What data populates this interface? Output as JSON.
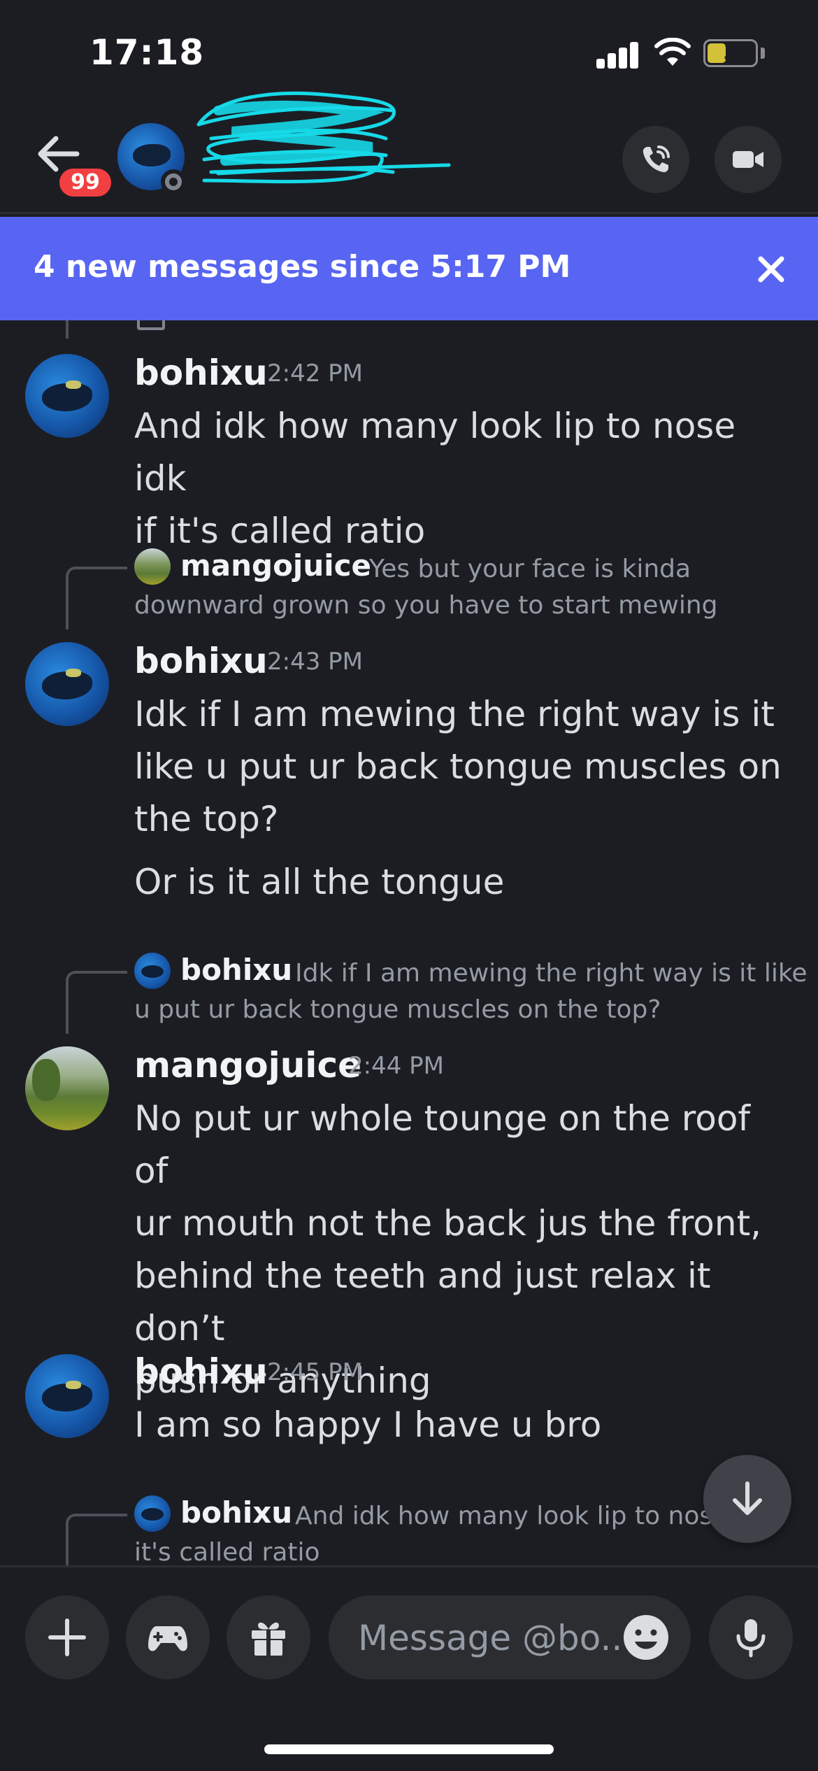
{
  "status_bar": {
    "time": "17:18",
    "battery": "3"
  },
  "header": {
    "unread_badge": "99"
  },
  "banner": {
    "text": "4 new messages since 5:17 PM"
  },
  "messages": [
    {
      "author": "bohixu",
      "time": "2:42 PM",
      "lines": [
        "And idk how many look lip to nose idk",
        "if it's called ratio"
      ]
    },
    {
      "reply": {
        "author": "mangojuice",
        "text_first": "Yes but your face is kinda",
        "text_second": "downward grown so you have to start mewing"
      },
      "author": "bohixu",
      "time": "2:43 PM",
      "lines": [
        "Idk if I am mewing the right way is it",
        "like u put ur back tongue muscles on",
        "the top?"
      ],
      "extra": "Or is it all the tongue"
    },
    {
      "reply": {
        "author": "bohixu",
        "text_first": "Idk if I am mewing the right way is it like",
        "text_second": "u put ur back tongue muscles on the top?"
      },
      "author": "mangojuice",
      "time": "2:44 PM",
      "lines": [
        "No put ur whole tounge on the roof of",
        "ur mouth not the back jus the front,",
        "behind the teeth and just relax it don’t",
        "push or anything"
      ]
    },
    {
      "author": "bohixu",
      "time": "2:45 PM",
      "lines": [
        "I am so happy I have u bro"
      ]
    },
    {
      "reply": {
        "author": "bohixu",
        "text_first": "And idk how many look lip to nose",
        "text_second": "it's called ratio"
      }
    }
  ],
  "composer": {
    "placeholder": "Message @bo.."
  },
  "icons": {
    "back": "back-arrow-icon",
    "call": "phone-call-icon",
    "video": "video-camera-icon",
    "close": "close-icon",
    "plus": "plus-icon",
    "games": "gamepad-icon",
    "gift": "gift-icon",
    "emoji": "emoji-icon",
    "mic": "microphone-icon",
    "scroll": "arrow-down-icon"
  },
  "colors": {
    "banner": "#5865f2",
    "badge": "#f23f42",
    "background": "#1c1d23"
  }
}
